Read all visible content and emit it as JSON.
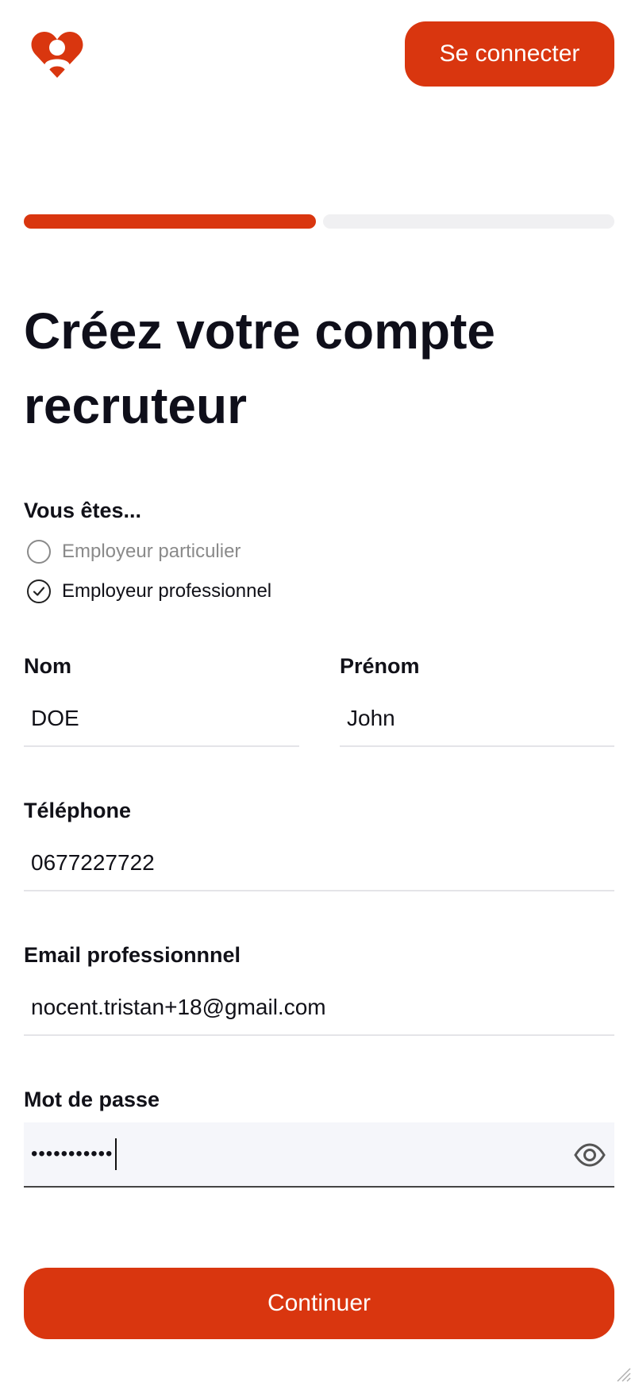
{
  "header": {
    "logo_icon": "heart-person-logo-icon",
    "login_label": "Se connecter"
  },
  "colors": {
    "brand": "#d9360f",
    "progress_track": "#f0f0f2",
    "text": "#111118",
    "muted": "#8a8a8a"
  },
  "progress": {
    "current_step": 1,
    "total_steps": 2
  },
  "form": {
    "title_line1": "Créez votre compte",
    "title_line2": "recruteur",
    "employer_type": {
      "label": "Vous êtes...",
      "options": [
        {
          "label": "Employeur particulier",
          "selected": false
        },
        {
          "label": "Employeur professionnel",
          "selected": true
        }
      ]
    },
    "last_name": {
      "label": "Nom",
      "value": "DOE"
    },
    "first_name": {
      "label": "Prénom",
      "value": "John"
    },
    "phone": {
      "label": "Téléphone",
      "value": "0677227722"
    },
    "email": {
      "label": "Email professionnnel",
      "value": "nocent.tristan+18@gmail.com"
    },
    "password": {
      "label": "Mot de passe",
      "value": "•••••••••••",
      "toggle_icon": "eye-icon"
    },
    "continue_label": "Continuer"
  }
}
